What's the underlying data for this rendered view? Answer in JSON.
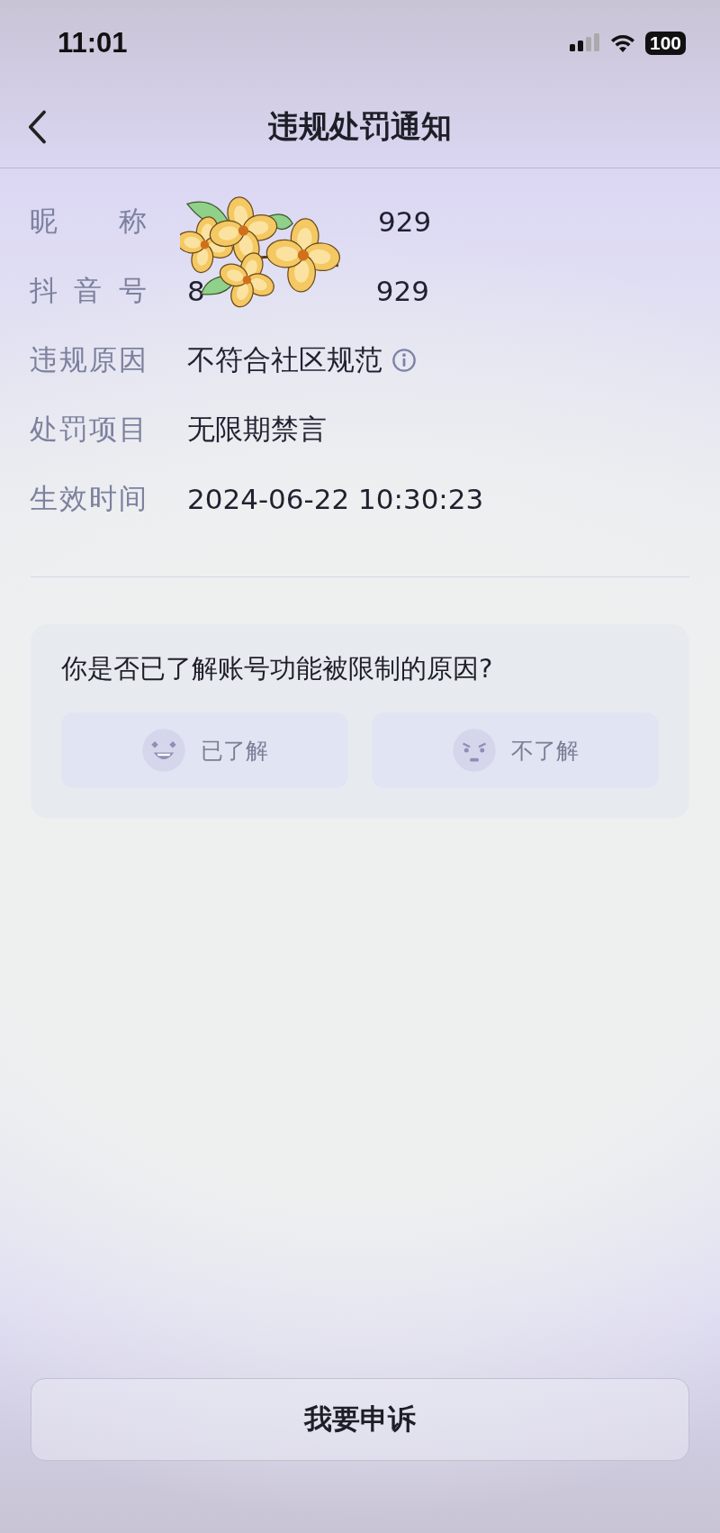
{
  "status_bar": {
    "time": "11:01",
    "battery": "100"
  },
  "nav": {
    "title": "违规处罚通知"
  },
  "details": [
    {
      "label": "昵 称",
      "value_parts": [
        "929"
      ]
    },
    {
      "label": "抖 音 号",
      "value_parts": [
        "8",
        "929"
      ]
    },
    {
      "label": "违规原因",
      "value_parts": [
        "不符合社区规范"
      ],
      "has_info": true
    },
    {
      "label": "处罚项目",
      "value_parts": [
        "无限期禁言"
      ]
    },
    {
      "label": "生效时间",
      "value_parts": [
        "2024-06-22 10:30:23"
      ]
    }
  ],
  "survey": {
    "question": "你是否已了解账号功能被限制的原因?",
    "options": [
      {
        "label": "已了解",
        "kind": "happy"
      },
      {
        "label": "不了解",
        "kind": "upset"
      }
    ]
  },
  "appeal_button": "我要申诉"
}
